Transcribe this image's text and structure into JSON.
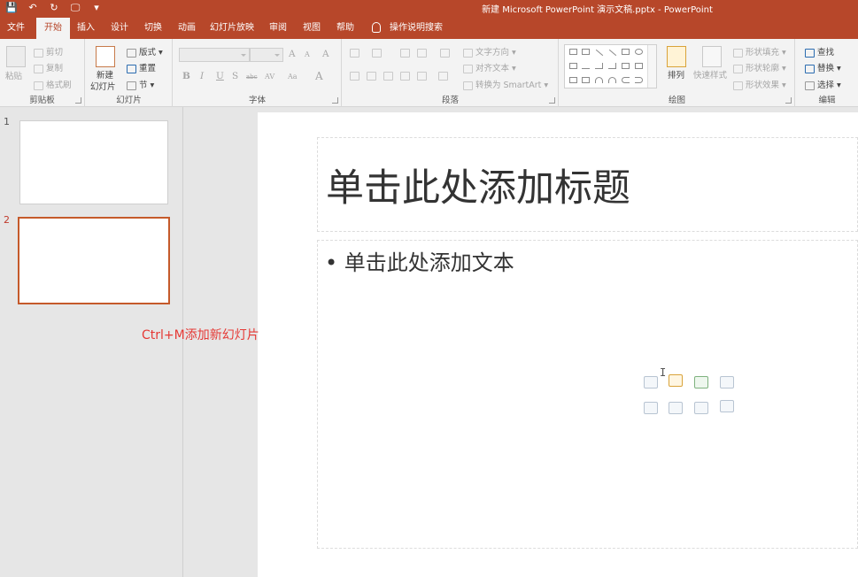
{
  "titlebar": {
    "title": "新建 Microsoft PowerPoint 演示文稿.pptx  -  PowerPoint",
    "qat": {
      "save": "💾",
      "undo": "↶",
      "redo": "↻",
      "start": "🖵",
      "more": "▾"
    }
  },
  "tabs": [
    {
      "label": "文件"
    },
    {
      "label": "开始"
    },
    {
      "label": "插入"
    },
    {
      "label": "设计"
    },
    {
      "label": "切换"
    },
    {
      "label": "动画"
    },
    {
      "label": "幻灯片放映"
    },
    {
      "label": "审阅"
    },
    {
      "label": "视图"
    },
    {
      "label": "帮助"
    }
  ],
  "active_tab": "开始",
  "tell_me": "操作说明搜索",
  "ribbon": {
    "clipboard": {
      "label": "剪贴板",
      "paste": "粘贴",
      "cut": "剪切",
      "copy": "复制",
      "format_painter": "格式刷"
    },
    "slides": {
      "label": "幻灯片",
      "new_slide_1": "新建",
      "new_slide_2": "幻灯片",
      "layout": "版式",
      "reset": "重置",
      "section": "节"
    },
    "font": {
      "label": "字体",
      "grow": "A",
      "shrink": "A",
      "clear": "A",
      "bold": "B",
      "italic": "I",
      "underline": "U",
      "shadow": "S",
      "strike": "abc",
      "spacing": "AV",
      "case": "Aa",
      "color": "A"
    },
    "paragraph": {
      "label": "段落",
      "text_direction": "文字方向",
      "align_text": "对齐文本",
      "smartart": "转换为 SmartArt"
    },
    "drawing": {
      "label": "绘图",
      "arrange": "排列",
      "quick_styles": "快速样式",
      "shape_fill": "形状填充",
      "shape_outline": "形状轮廓",
      "shape_effects": "形状效果"
    },
    "editing": {
      "label": "编辑",
      "find": "查找",
      "replace": "替换",
      "select": "选择"
    }
  },
  "slides": [
    {
      "number": "1"
    },
    {
      "number": "2"
    }
  ],
  "active_slide": "2",
  "slide": {
    "title_placeholder": "单击此处添加标题",
    "body_placeholder": "• 单击此处添加文本"
  },
  "annotation": "Ctrl+M添加新幻灯片",
  "colors": {
    "accent": "#b7472a",
    "hint": "#e53935",
    "active_thumb_border": "#c55a2b"
  }
}
